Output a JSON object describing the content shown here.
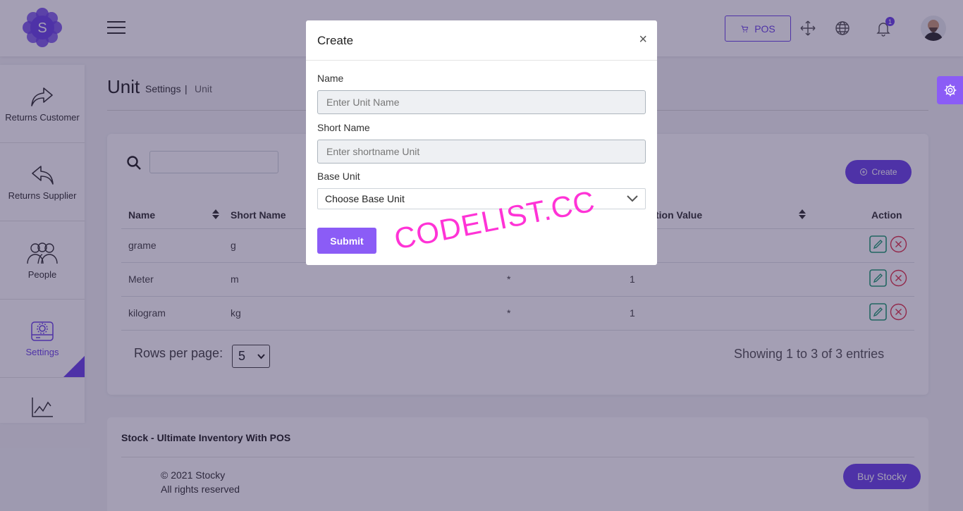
{
  "header": {
    "logo_letter": "S",
    "pos_label": "POS",
    "notification_count": "1"
  },
  "sidebar": {
    "items": [
      {
        "label": "Returns Customer",
        "icon": "share-forward-icon"
      },
      {
        "label": "Returns Supplier",
        "icon": "reply-icon"
      },
      {
        "label": "People",
        "icon": "people-icon"
      },
      {
        "label": "Settings",
        "icon": "settings-drive-icon",
        "active": true
      },
      {
        "label": "",
        "icon": "chart-line-icon"
      }
    ]
  },
  "page": {
    "title": "Unit",
    "breadcrumb_parent": "Settings",
    "breadcrumb_sep": "|",
    "breadcrumb_current": "Unit"
  },
  "toolbar": {
    "search_value": "",
    "create_label": "Create"
  },
  "table": {
    "columns": [
      "Name",
      "Short Name",
      "tion Value",
      "Action"
    ],
    "rows": [
      {
        "name": "grame",
        "short": "g",
        "base": "",
        "value": ""
      },
      {
        "name": "Meter",
        "short": "m",
        "base": "*",
        "value": "1"
      },
      {
        "name": "kilogram",
        "short": "kg",
        "base": "*",
        "value": "1"
      }
    ]
  },
  "pagination": {
    "rows_per_page_label": "Rows per page:",
    "rows_per_page_value": "5",
    "showing": "Showing 1 to 3 of 3 entries"
  },
  "footer": {
    "title": "Stock - Ultimate Inventory With POS",
    "copyright": "© 2021 Stocky",
    "rights": "All rights reserved",
    "buy_label": "Buy Stocky"
  },
  "modal": {
    "title": "Create",
    "close_glyph": "×",
    "name_label": "Name",
    "name_placeholder": "Enter Unit Name",
    "short_label": "Short Name",
    "short_placeholder": "Enter shortname Unit",
    "base_label": "Base Unit",
    "base_value": "Choose Base Unit",
    "submit_label": "Submit"
  },
  "watermark": "CODELIST.CC",
  "colors": {
    "accent": "#6c44e8",
    "accent_light": "#8b5cf6",
    "edit_green": "#1f9d73",
    "delete_red": "#e0344a"
  }
}
